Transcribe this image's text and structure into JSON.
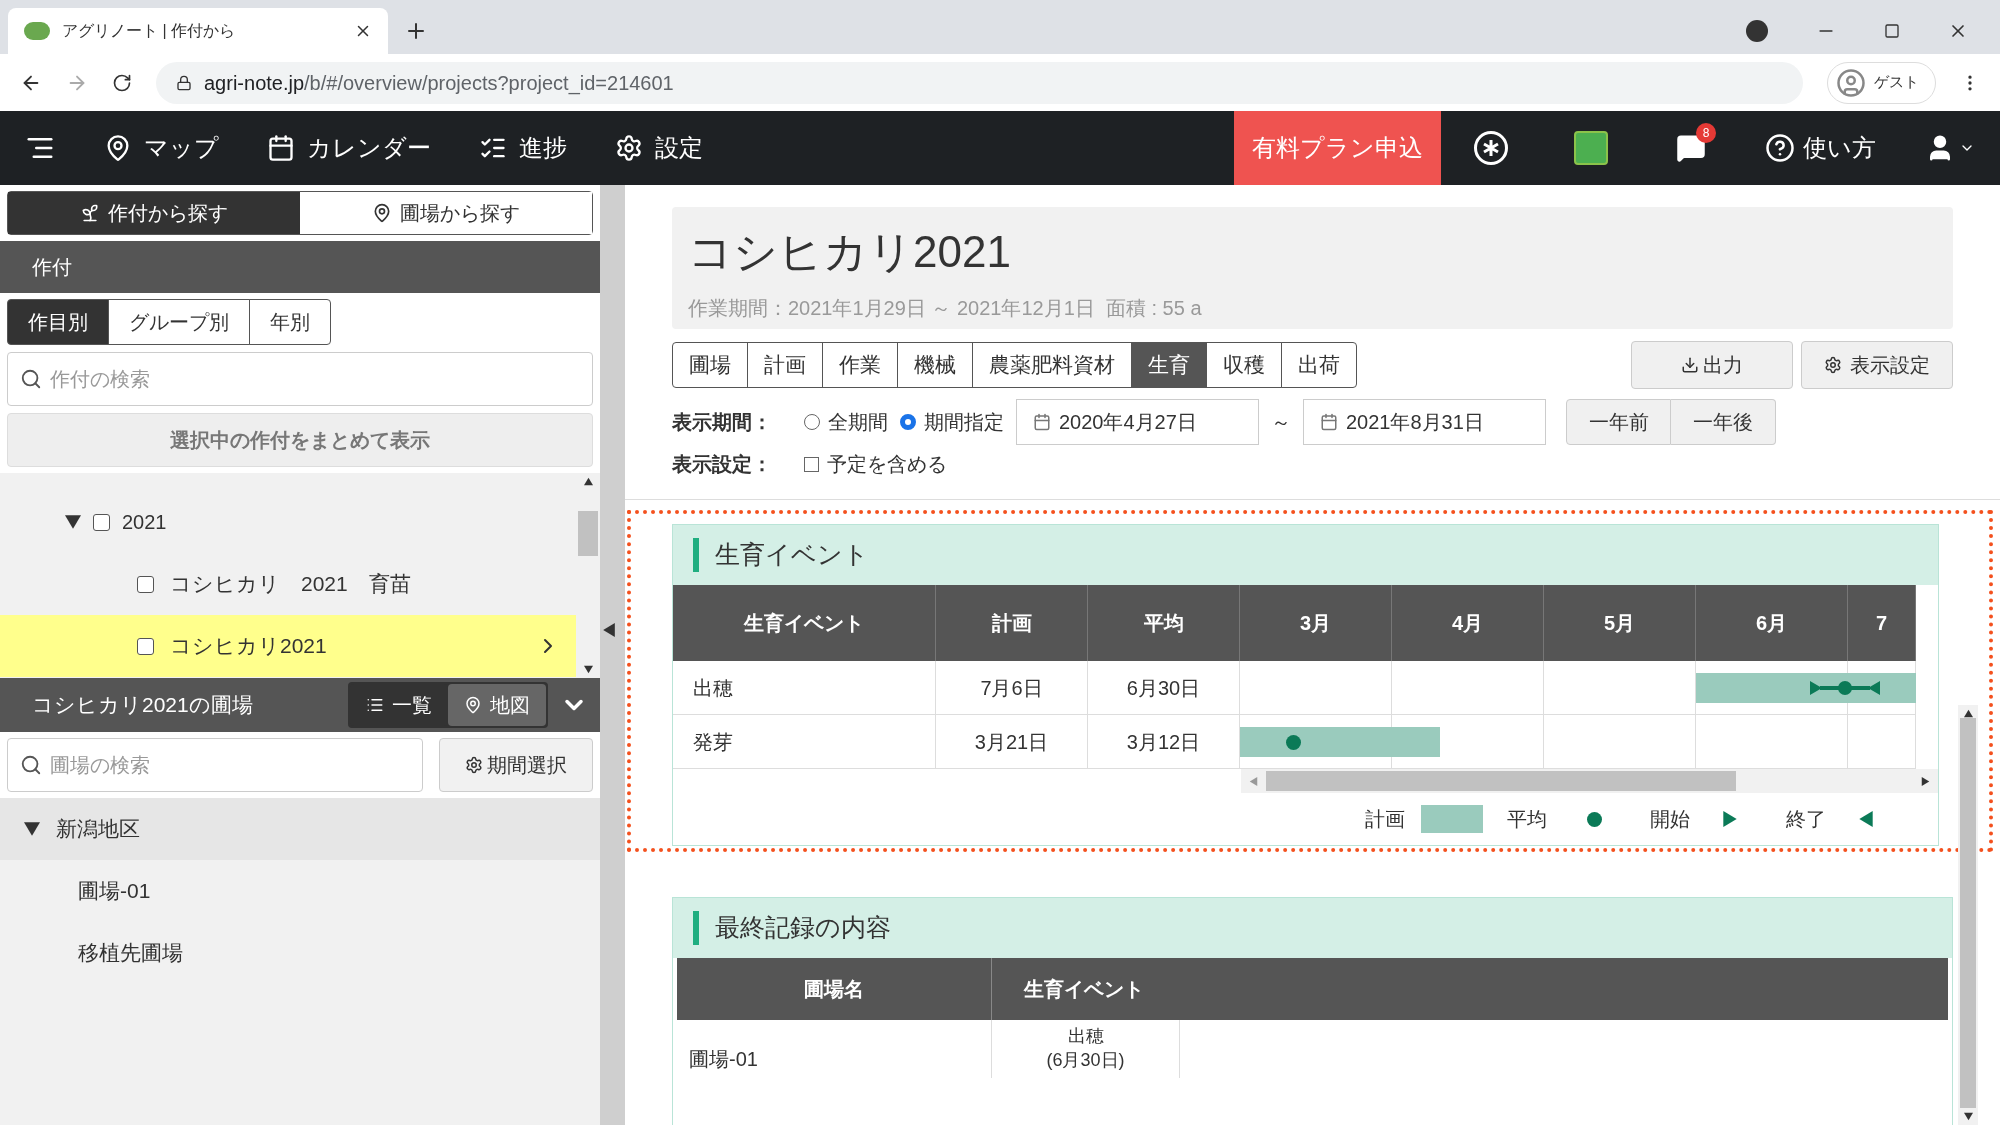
{
  "browser": {
    "tab_title": "アグリノート | 作付から",
    "url_host": "agri-note.jp",
    "url_path": "/b/#/overview/projects?project_id=214601",
    "profile": "ゲスト"
  },
  "nav": {
    "items": [
      {
        "label": "マップ",
        "kind": "pin"
      },
      {
        "label": "カレンダー",
        "kind": "calendar"
      },
      {
        "label": "進捗",
        "kind": "list"
      },
      {
        "label": "設定",
        "kind": "gear"
      }
    ],
    "plan_button": "有料プラン申込",
    "notifications": "8",
    "help": "使い方"
  },
  "sidebar": {
    "search_tabs": [
      {
        "label": "作付から探す",
        "selected": true
      },
      {
        "label": "圃場から探す",
        "selected": false
      }
    ],
    "section_title": "作付",
    "group_tabs": [
      {
        "label": "作目別",
        "selected": true
      },
      {
        "label": "グループ別",
        "selected": false
      },
      {
        "label": "年別",
        "selected": false
      }
    ],
    "search": {
      "placeholder": "作付の検索"
    },
    "combine_button": "選択中の作付をまとめて表示",
    "tree": [
      {
        "label": "2021",
        "expanded": true,
        "checked": false,
        "children": [
          {
            "label": "コシヒカリ　2021　育苗",
            "checked": false,
            "selected": false
          },
          {
            "label": "コシヒカリ2021",
            "checked": false,
            "selected": true
          }
        ]
      }
    ],
    "fields_title": "コシヒカリ2021の圃場",
    "view_toggle": [
      {
        "label": "一覧",
        "selected": true
      },
      {
        "label": "地図",
        "selected": false
      }
    ],
    "field_search": {
      "placeholder": "圃場の検索"
    },
    "period_button": "期間選択",
    "areas": [
      {
        "label": "新潟地区",
        "expanded": true,
        "children": [
          {
            "label": "圃場-01"
          },
          {
            "label": "移植先圃場"
          }
        ]
      }
    ]
  },
  "main": {
    "title": "コシヒカリ2021",
    "subtitle": "作業期間：2021年1月29日 ～ 2021年12月1日  面積 : 55 a",
    "tabs": [
      {
        "label": "圃場",
        "selected": false
      },
      {
        "label": "計画",
        "selected": false
      },
      {
        "label": "作業",
        "selected": false
      },
      {
        "label": "機械",
        "selected": false
      },
      {
        "label": "農薬肥料資材",
        "selected": false
      },
      {
        "label": "生育",
        "selected": true
      },
      {
        "label": "収穫",
        "selected": false
      },
      {
        "label": "出荷",
        "selected": false
      }
    ],
    "export_button": "出力",
    "display_button": "表示設定",
    "period_label": "表示期間：",
    "period_options": [
      {
        "label": "全期間",
        "selected": false
      },
      {
        "label": "期間指定",
        "selected": true
      }
    ],
    "date_from": "2020年4月27日",
    "range_sep": "～",
    "date_to": "2021年8月31日",
    "year_prev": "一年前",
    "year_next": "一年後",
    "settings_label": "表示設定：",
    "include_plans": {
      "label": "予定を含める",
      "checked": false
    },
    "growth": {
      "title": "生育イベント",
      "columns": [
        "生育イベント",
        "計画",
        "平均",
        "3月",
        "4月",
        "5月",
        "6月",
        "7"
      ],
      "rows": [
        {
          "event": "出穂",
          "plan": "7月6日",
          "average": "6月30日",
          "kind": "range"
        },
        {
          "event": "発芽",
          "plan": "3月21日",
          "average": "3月12日",
          "kind": "single"
        }
      ],
      "legend": {
        "plan": "計画",
        "average": "平均",
        "start": "開始",
        "end": "終了"
      }
    },
    "last_record": {
      "title": "最終記録の内容",
      "columns": [
        "圃場名",
        "生育イベント"
      ],
      "rows": [
        {
          "field": "圃場-01",
          "event": "出穂",
          "date": "(6月30日)"
        }
      ]
    }
  }
}
